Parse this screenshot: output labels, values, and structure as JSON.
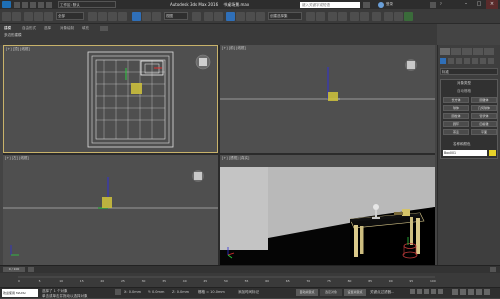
{
  "titlebar": {
    "app_title": "Autodesk 3ds Max 2016",
    "file_name": "书桌场景.max",
    "workspace_label": "工作区: 默认",
    "search_placeholder": "键入关键字或短语",
    "signin_label": "登录",
    "help_label": "?"
  },
  "toolbar": {
    "selection_set_label": "全部",
    "view_dropdown": "视图",
    "named_selection": "创建选择集"
  },
  "ribbon": {
    "tabs": [
      "建模",
      "自由形式",
      "选择",
      "对象绘制",
      "填充"
    ],
    "sub_label": "多边形建模"
  },
  "viewports": {
    "top": "[+] [顶] [线框]",
    "front": "[+] [前] [线框]",
    "left": "[+] [左] [线框]",
    "perspective": "[+] [透视] [真实]"
  },
  "command_panel": {
    "dropdown": "标准基本体",
    "category": "标准",
    "rollout_object_type": "对象类型",
    "autogrid": "自动栅格",
    "buttons": [
      "长方体",
      "圆锥体",
      "球体",
      "几何球体",
      "圆柱体",
      "管状体",
      "圆环",
      "四棱锥",
      "茶壶",
      "平面"
    ],
    "rollout_name_color": "名称和颜色",
    "name_value": "Box001",
    "accent_color": "#e8d32a"
  },
  "timeline": {
    "frame_label": "0 / 100",
    "ticks": [
      "0",
      "5",
      "10",
      "15",
      "20",
      "25",
      "30",
      "35",
      "40",
      "45",
      "50",
      "55",
      "60",
      "65",
      "70",
      "75",
      "80",
      "85",
      "90",
      "95",
      "100"
    ]
  },
  "statusbar": {
    "selection_info": "选择了 1 个对象",
    "prompt": "单击或单击并拖动以选择对象",
    "maxscript": "欢迎使用 MAXSc",
    "coord_x": "X: 0.0mm",
    "coord_y": "Y: 0.0mm",
    "coord_z": "Z: 0.0mm",
    "grid": "栅格 = 10.0mm",
    "autokey": "自动关键点",
    "setkey": "设置关键点",
    "selected": "选定对象",
    "add_time_tag": "添加时间标记",
    "keyfilter": "关键点过滤器..."
  }
}
